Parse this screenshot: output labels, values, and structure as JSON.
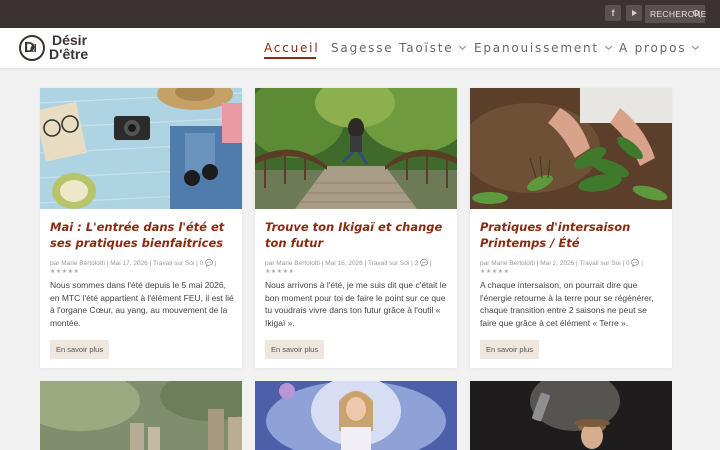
{
  "topbar": {
    "social": [
      {
        "name": "facebook",
        "glyph": "f"
      },
      {
        "name": "youtube",
        "glyph": ""
      }
    ],
    "search_label": "RECHERCHE"
  },
  "brand": {
    "line1": "Désir",
    "line2": "D'être",
    "mark_left": "D",
    "mark_right": "d",
    "color": "#3b3331"
  },
  "nav": [
    {
      "label": "Accueil",
      "active": true
    },
    {
      "label": "Sagesse Taoïste",
      "has_menu": true
    },
    {
      "label": "Epanouissement",
      "has_menu": true
    },
    {
      "label": "A propos",
      "has_menu": true
    }
  ],
  "colors": {
    "accent": "#8a2a12",
    "topbar": "#3b3331",
    "button_bg": "#efe7dd"
  },
  "posts": [
    {
      "title": "Mai : L'entrée dans l'été et ses pratiques bienfaitrices",
      "meta": "par Marie Bertolotti | Mai 17, 2026 | Travail sur Soi | 0 💬 |",
      "rating": "★★★★★",
      "excerpt": "Nous sommes dans l'été depuis le 5 mai 2026, en MTC l'été appartient à l'élément FEU, il est lié à l'organe Cœur, au yang, au mouvement de la montée.",
      "button": "En savoir plus"
    },
    {
      "title": "Trouve ton Ikigaï et change ton futur",
      "meta": "par Marie Bertolotti | Mai 16, 2026 | Travail sur Soi | 2 💬 |",
      "rating": "★★★★★",
      "excerpt": "Nous arrivons à l'été, je me suis dit que c'était le bon moment pour toi de faire le point sur ce que tu voudrais vivre dans ton futur grâce à l'outil « Ikigaï ».",
      "button": "En savoir plus"
    },
    {
      "title": "Pratiques d'intersaison Printemps / Été",
      "meta": "par Marie Bertolotti | Mai 2, 2026 | Travail sur Soi | 0 💬 |",
      "rating": "★★★★★",
      "excerpt": "A chaque intersaison, on pourrait dire que l'énergie retourne à la terre pour se régénérer, chaque transition entre 2 saisons ne peut se faire que grâce à cet élément « Terre ».",
      "button": "En savoir plus"
    }
  ]
}
